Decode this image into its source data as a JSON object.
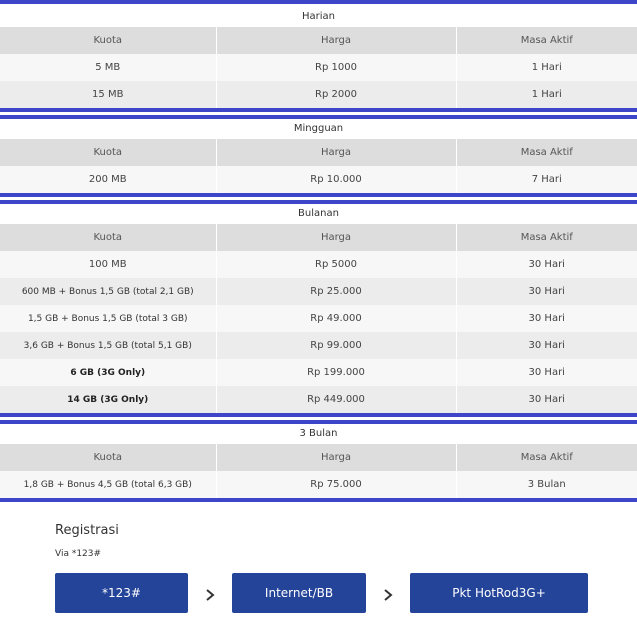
{
  "columns": {
    "kuota": "Kuota",
    "harga": "Harga",
    "masa": "Masa Aktif"
  },
  "sections": [
    {
      "title": "Harian",
      "rows": [
        {
          "kuota": "5 MB",
          "harga": "Rp 1000",
          "masa": "1 Hari"
        },
        {
          "kuota": "15 MB",
          "harga": "Rp 2000",
          "masa": "1 Hari"
        }
      ]
    },
    {
      "title": "Mingguan",
      "rows": [
        {
          "kuota": "200 MB",
          "harga": "Rp 10.000",
          "masa": "7 Hari"
        }
      ]
    },
    {
      "title": "Bulanan",
      "rows": [
        {
          "kuota": "100 MB",
          "harga": "Rp 5000",
          "masa": "30 Hari"
        },
        {
          "kuota": "600 MB + Bonus 1,5 GB (total 2,1 GB)",
          "harga": "Rp 25.000",
          "masa": "30 Hari"
        },
        {
          "kuota": "1,5 GB + Bonus 1,5 GB (total 3 GB)",
          "harga": "Rp 49.000",
          "masa": "30 Hari"
        },
        {
          "kuota": "3,6 GB + Bonus 1,5 GB (total 5,1 GB)",
          "harga": "Rp 99.000",
          "masa": "30 Hari"
        },
        {
          "kuota": "6 GB (3G Only)",
          "harga": "Rp 199.000",
          "masa": "30 Hari"
        },
        {
          "kuota": "14 GB (3G Only)",
          "harga": "Rp 449.000",
          "masa": "30 Hari"
        }
      ]
    },
    {
      "title": "3 Bulan",
      "rows": [
        {
          "kuota": "1,8 GB + Bonus 4,5 GB (total 6,3 GB)",
          "harga": "Rp 75.000",
          "masa": "3 Bulan"
        }
      ]
    }
  ],
  "registration": {
    "title": "Registrasi",
    "via": "Via *123#",
    "steps": [
      "*123#",
      "Internet/BB",
      "Pkt HotRod3G+"
    ]
  },
  "colors": {
    "accent_bar": "#3d45c9",
    "button": "#24449a"
  }
}
